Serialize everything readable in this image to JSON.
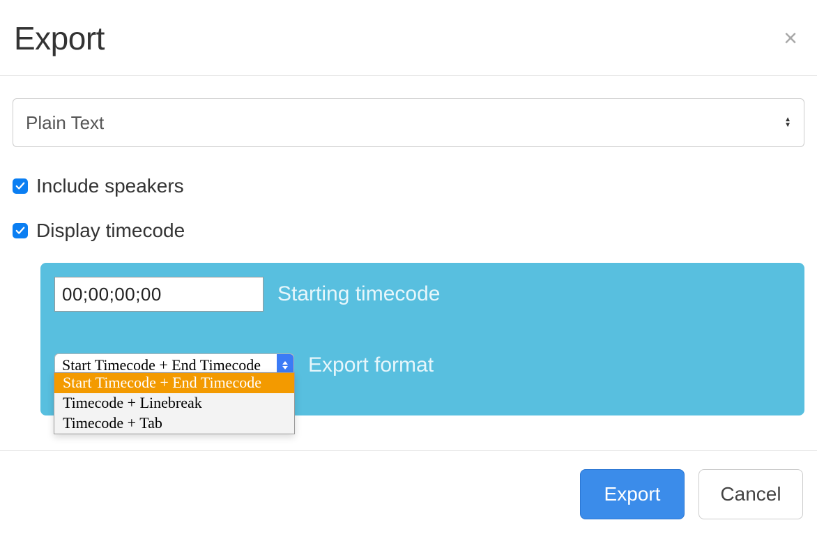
{
  "header": {
    "title": "Export",
    "close_icon": "×"
  },
  "format_select": {
    "value": "Plain Text"
  },
  "options": {
    "include_speakers": {
      "label": "Include speakers",
      "checked": true
    },
    "display_timecode": {
      "label": "Display timecode",
      "checked": true
    }
  },
  "panel": {
    "starting_timecode": {
      "value": "00;00;00;00",
      "label": "Starting timecode"
    },
    "export_format": {
      "label": "Export format",
      "selected": "Start Timecode + End Timecode",
      "options": [
        "Start Timecode + End Timecode",
        "Timecode + Linebreak",
        "Timecode + Tab"
      ]
    }
  },
  "footer": {
    "primary": "Export",
    "cancel": "Cancel"
  }
}
